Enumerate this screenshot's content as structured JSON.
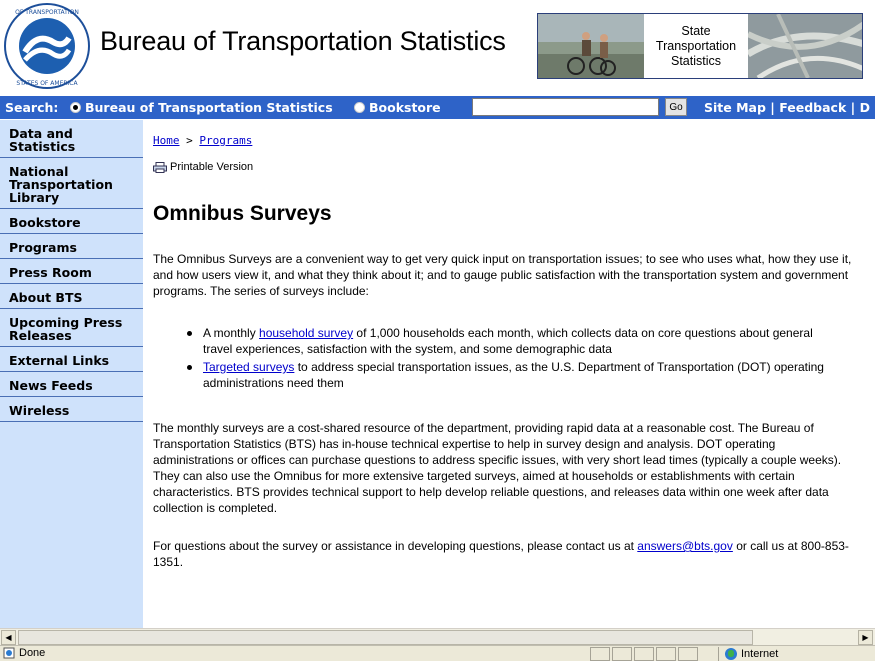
{
  "header": {
    "site_title": "Bureau of Transportation Statistics",
    "seal_alt": "Department of Transportation seal",
    "banner_label": "State\nTransportation\nStatistics"
  },
  "search": {
    "label": "Search:",
    "option_bts": "Bureau of Transportation Statistics",
    "option_bookstore": "Bookstore",
    "selected": "Bureau of Transportation Statistics",
    "input_value": "",
    "go_label": "Go",
    "links": [
      "Site Map",
      "Feedback",
      "D"
    ],
    "separator": "|"
  },
  "sidebar": {
    "items": [
      {
        "label": "Data and Statistics"
      },
      {
        "label": "National Transportation Library"
      },
      {
        "label": "Bookstore"
      },
      {
        "label": "Programs"
      },
      {
        "label": "Press Room"
      },
      {
        "label": "About BTS"
      },
      {
        "label": "Upcoming Press Releases"
      },
      {
        "label": "External Links"
      },
      {
        "label": "News Feeds"
      },
      {
        "label": "Wireless"
      }
    ]
  },
  "breadcrumb": {
    "home": "Home",
    "separator": ">",
    "current": "Programs"
  },
  "printable": "Printable Version",
  "page_title": "Omnibus Surveys",
  "intro": "The Omnibus Surveys are a convenient way to get very quick input on transportation issues; to see who uses what, how they use it, and how users view it, and what they think about it; and to gauge public satisfaction with the transportation system and government programs. The series of surveys include:",
  "bullets": [
    {
      "prefix": "A monthly ",
      "link": "household survey",
      "suffix": " of 1,000 households each month, which collects data on core questions about general travel experiences, satisfaction with the system, and some demographic data"
    },
    {
      "prefix": "",
      "link": "Targeted surveys",
      "suffix": " to address special transportation issues, as the U.S. Department of Transportation (DOT) operating administrations need them"
    }
  ],
  "para2": "The monthly surveys are a cost-shared resource of the department, providing rapid data at a reasonable cost. The Bureau of Transportation Statistics (BTS) has in-house technical expertise to help in survey design and analysis. DOT operating administrations or offices can purchase questions to address specific issues, with very short lead times (typically a couple weeks). They can also use the Omnibus for more extensive targeted surveys, aimed at households or establishments with certain characteristics. BTS provides technical support to help develop reliable questions, and releases data within one week after data collection is completed.",
  "contact": {
    "prefix": "For questions about the survey or assistance in developing questions, please contact us at ",
    "email": "answers@bts.gov",
    "suffix": " or call us at 800-853-1351."
  },
  "status": {
    "left": "Done",
    "zone": "Internet"
  },
  "colors": {
    "search_bar": "#2e63c8",
    "sidebar_bg": "#cfe2fb",
    "link": "#0000cc"
  }
}
